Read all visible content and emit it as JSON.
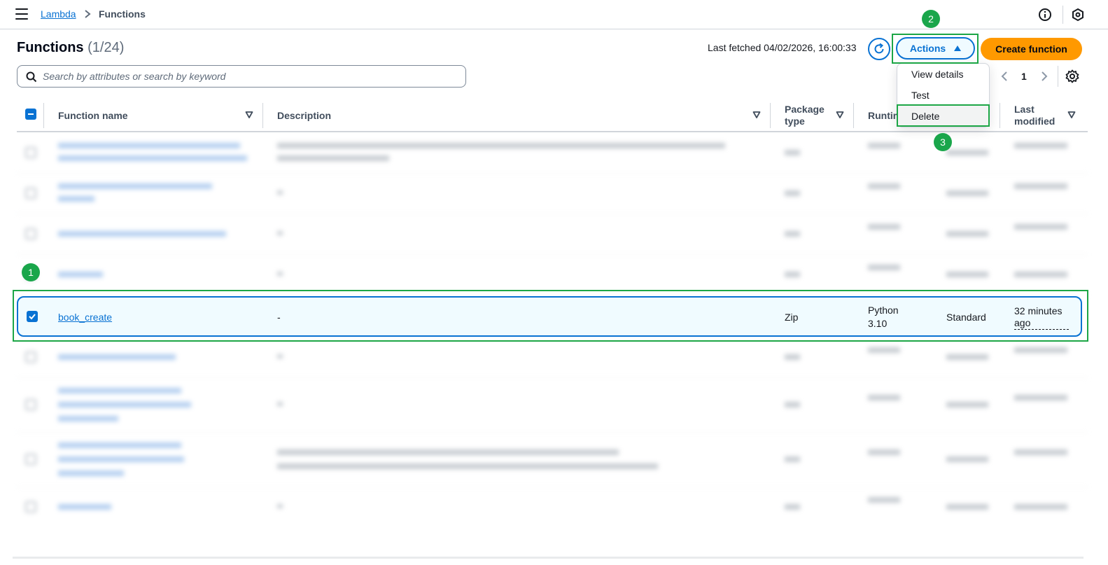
{
  "breadcrumb": {
    "service": "Lambda",
    "current": "Functions"
  },
  "header": {
    "title": "Functions",
    "count": "(1/24)",
    "last_fetched": "Last fetched 04/02/2026, 16:00:33",
    "actions_label": "Actions",
    "create_label": "Create function"
  },
  "search": {
    "placeholder": "Search by attributes or search by keyword"
  },
  "pagination": {
    "current_page": "1"
  },
  "table": {
    "columns": {
      "function_name": "Function name",
      "description": "Description",
      "package_type_line1": "Package",
      "package_type_line2": "type",
      "runtime": "Runtime",
      "last_modified_line1": "Last",
      "last_modified_line2": "modified"
    },
    "selected_row": {
      "function_name": "book_create",
      "description": "-",
      "package_type": "Zip",
      "runtime_line1": "Python",
      "runtime_line2": "3.10",
      "code_storage": "Standard",
      "last_modified_line1": "32 minutes",
      "last_modified_line2": "ago"
    }
  },
  "actions_menu": {
    "items": [
      "View details",
      "Test",
      "Delete"
    ]
  },
  "annotations": {
    "step1": "1",
    "step2": "2",
    "step3": "3"
  },
  "colors": {
    "accent": "#0972d3",
    "primary": "#ff9900",
    "annotation": "#1da646"
  }
}
